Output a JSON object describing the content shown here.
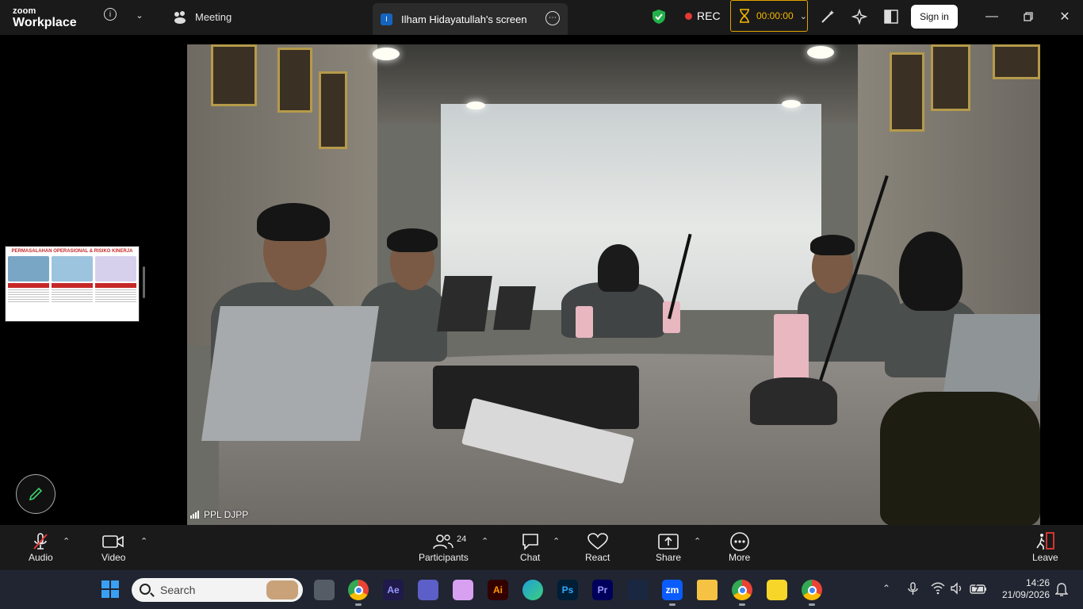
{
  "app": {
    "brand_small": "zoom",
    "brand_big": "Workplace"
  },
  "topbar": {
    "meeting_label": "Meeting",
    "share_tab_label": "Ilham Hidayatullah's screen",
    "share_tab_icon_letter": "I",
    "rec_label": "REC",
    "timer": "00:00:00",
    "signin_label": "Sign in"
  },
  "stage": {
    "video_label": "PPL DJPP",
    "thumbnail": {
      "title": "PERMASALAHAN OPERASIONAL & RISIKO KINERJA"
    }
  },
  "toolbar": {
    "audio": "Audio",
    "video": "Video",
    "participants": "Participants",
    "participants_count": "24",
    "chat": "Chat",
    "react": "React",
    "share": "Share",
    "more": "More",
    "leave": "Leave"
  },
  "taskbar": {
    "search_placeholder": "Search",
    "time": "14:26",
    "date": "21/09/2026",
    "apps": [
      {
        "name": "chrome-icon",
        "label": "",
        "color": "#ffffff"
      },
      {
        "name": "after-effects-icon",
        "label": "Ae",
        "color": "#1f1a4a"
      },
      {
        "name": "teams-icon",
        "label": "",
        "color": "#5b5fc7"
      },
      {
        "name": "copilot-icon",
        "label": "",
        "color": "#d8a0f0"
      },
      {
        "name": "illustrator-icon",
        "label": "Ai",
        "color": "#330000"
      },
      {
        "name": "edge-icon",
        "label": "",
        "color": "#1fa0d8"
      },
      {
        "name": "photoshop-icon",
        "label": "Ps",
        "color": "#001e36"
      },
      {
        "name": "premiere-icon",
        "label": "Pr",
        "color": "#00005b"
      },
      {
        "name": "app-installer-icon",
        "label": "",
        "color": "#1a2740"
      },
      {
        "name": "zoom-icon",
        "label": "zm",
        "color": "#0b5cff"
      },
      {
        "name": "file-explorer-icon",
        "label": "",
        "color": "#f5c244"
      },
      {
        "name": "chrome-icon",
        "label": "",
        "color": "#ffffff"
      },
      {
        "name": "sticky-notes-icon",
        "label": "",
        "color": "#f7d629"
      },
      {
        "name": "chrome-icon",
        "label": "",
        "color": "#ffffff"
      }
    ]
  }
}
